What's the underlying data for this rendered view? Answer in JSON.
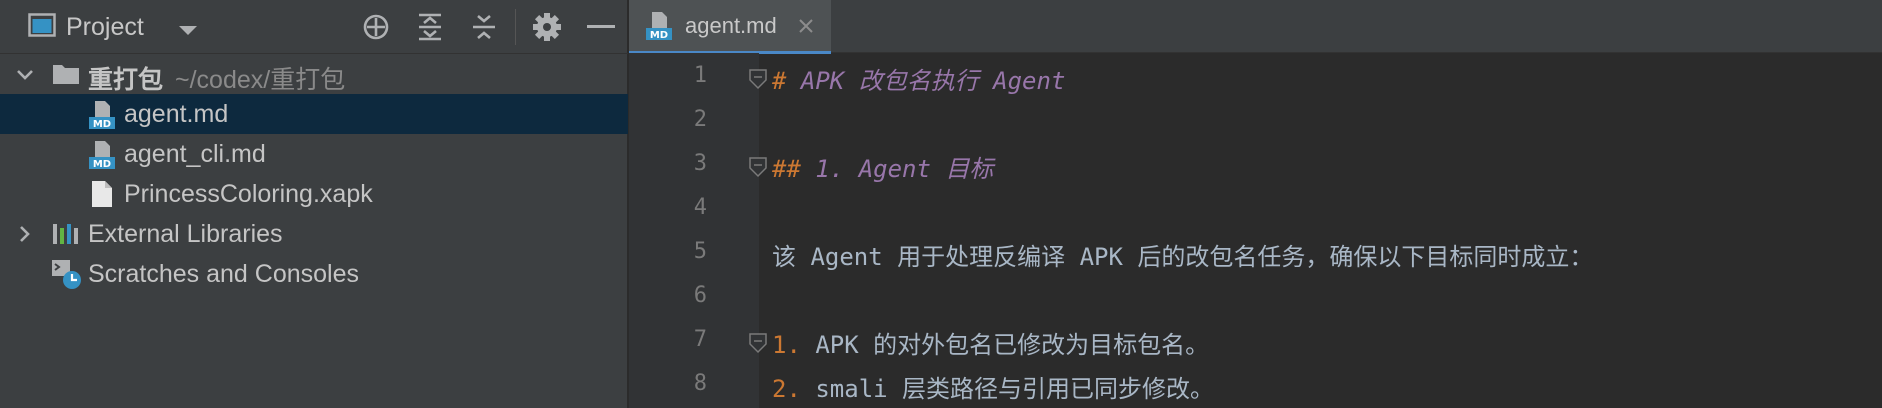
{
  "project_panel": {
    "title": "Project",
    "tree": {
      "root": {
        "name": "重打包",
        "path": "~/codex/重打包"
      },
      "files": [
        {
          "name": "agent.md",
          "icon": "markdown-file-icon",
          "selected": true
        },
        {
          "name": "agent_cli.md",
          "icon": "markdown-file-icon",
          "selected": false
        },
        {
          "name": "PrincessColoring.xapk",
          "icon": "generic-file-icon",
          "selected": false
        }
      ],
      "external_libraries": "External Libraries",
      "scratches": "Scratches and Consoles"
    }
  },
  "editor": {
    "tab": {
      "label": "agent.md"
    },
    "line_numbers": [
      "1",
      "2",
      "3",
      "4",
      "5",
      "6",
      "7",
      "8"
    ],
    "lines": {
      "l1_hash": "# ",
      "l1_text": "APK 改包名执行 Agent",
      "l3_hash": "## ",
      "l3_text": "1. Agent 目标",
      "l5_text": "该 Agent 用于处理反编译 APK 后的改包名任务，确保以下目标同时成立：",
      "l7_num": "1.",
      "l7_text": " APK 的对外包名已修改为目标包名。",
      "l8_num": "2.",
      "l8_text": " smali 层类路径与引用已同步修改。"
    }
  },
  "colors": {
    "selection": "#0d293e",
    "heading_hash": "#cc7832",
    "heading_text": "#9876aa",
    "list_number": "#cc7832",
    "plain_text": "#a9b7c6",
    "tab_underline": "#4a88c7"
  }
}
